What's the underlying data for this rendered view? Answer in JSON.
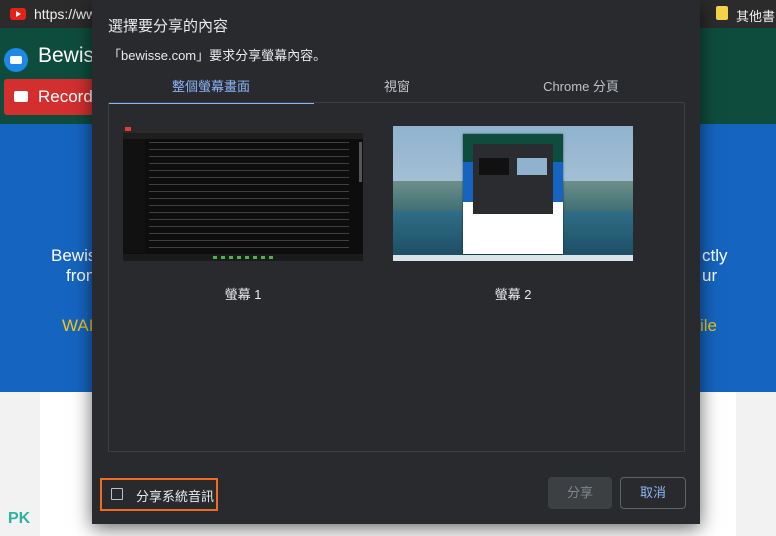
{
  "browser": {
    "url": "https://ww",
    "bookmark_label": "其他書"
  },
  "background_site": {
    "brand": "Bewis",
    "record_button": "Record",
    "text_left_1": "Bewis",
    "text_left_2": "from",
    "text_left_3": "WAI",
    "text_right_1": "ctly",
    "text_right_2": "ur",
    "text_right_3": "ile",
    "watermark": "PK"
  },
  "dialog": {
    "title": "選擇要分享的內容",
    "subtitle": "「bewisse.com」要求分享螢幕內容。",
    "tabs": [
      {
        "label": "整個螢幕畫面",
        "active": true
      },
      {
        "label": "視窗",
        "active": false
      },
      {
        "label": "Chrome 分頁",
        "active": false
      }
    ],
    "screens": [
      {
        "label": "螢幕 1"
      },
      {
        "label": "螢幕 2"
      }
    ],
    "share_audio_label": "分享系統音訊",
    "share_audio_checked": false,
    "share_button": "分享",
    "cancel_button": "取消"
  },
  "colors": {
    "dialog_bg": "#292a2d",
    "accent": "#8ab4f8",
    "highlight_border": "#f36b21",
    "site_header": "#0e4d3d",
    "site_blue": "#1565c0"
  }
}
